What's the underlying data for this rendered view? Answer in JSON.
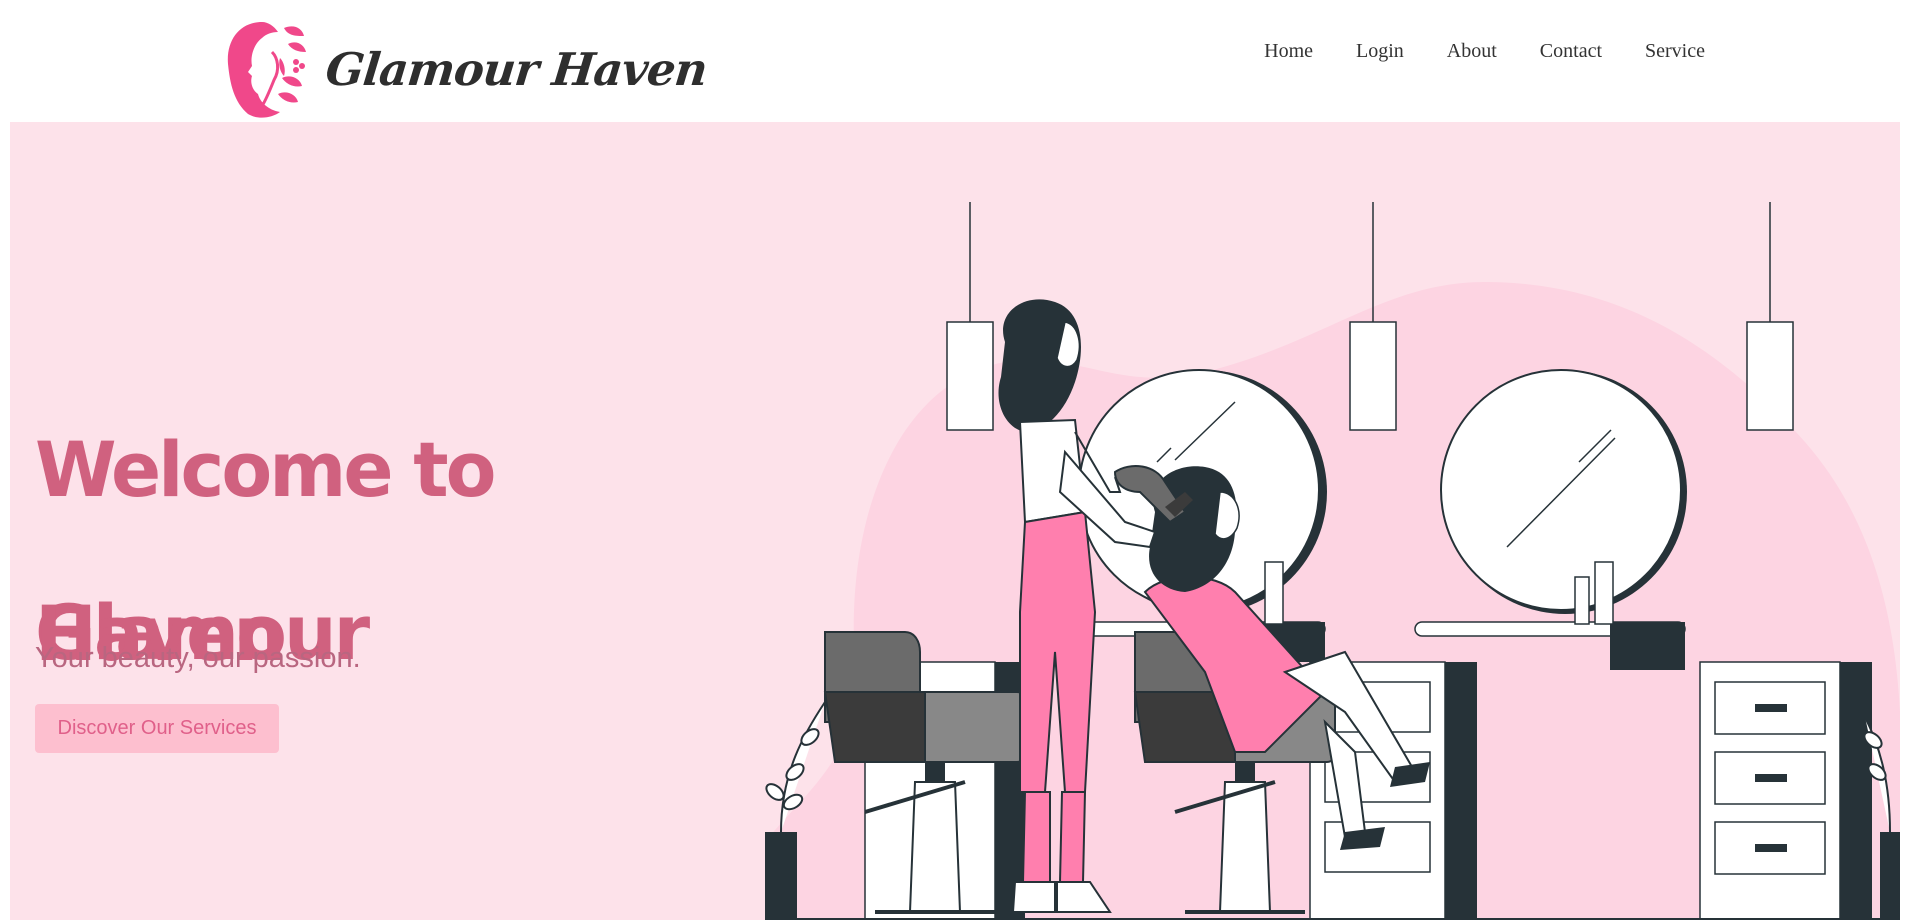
{
  "brand": {
    "name": "Glamour Haven",
    "logo_icon": "woman-flower-logo-icon"
  },
  "nav": {
    "items": [
      "Home",
      "Login",
      "About",
      "Contact",
      "Service"
    ]
  },
  "hero": {
    "title_line1": "Welcome to Glamour",
    "title_line2": "Haven",
    "subtitle": "Your beauty, our passion.",
    "cta": "Discover Our Services",
    "illustration": "salon-hairstylist-illustration"
  },
  "colors": {
    "accent": "#ff69a0",
    "hero_bg": "#fde2ea",
    "title": "#d0617f",
    "button_bg": "#fdbfcf",
    "button_text": "#e0608a",
    "dark": "#263238"
  }
}
